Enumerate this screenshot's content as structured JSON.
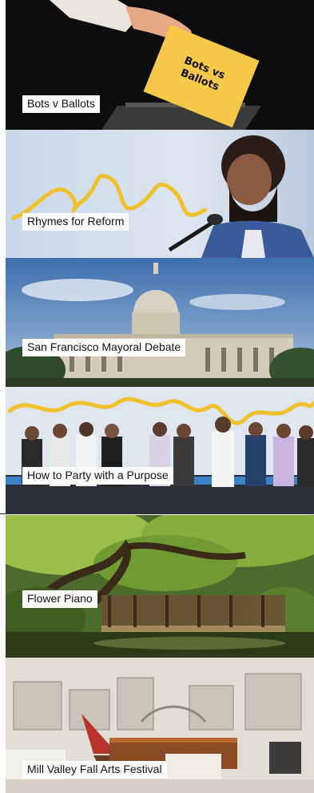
{
  "cards": [
    {
      "title": "Bots v Ballots",
      "sign_text_line1": "Bots vs",
      "sign_text_line2": "Ballots"
    },
    {
      "title": "Rhymes for Reform"
    },
    {
      "title": "San Francisco Mayoral Debate"
    },
    {
      "title": "How to Party with a Purpose"
    },
    {
      "title": "Flower Piano"
    },
    {
      "title": "Mill Valley Fall Arts Festival"
    }
  ],
  "colors": {
    "label_bg": "#ffffff",
    "label_text": "#111111",
    "squiggle_yellow": "#f2c12e"
  }
}
